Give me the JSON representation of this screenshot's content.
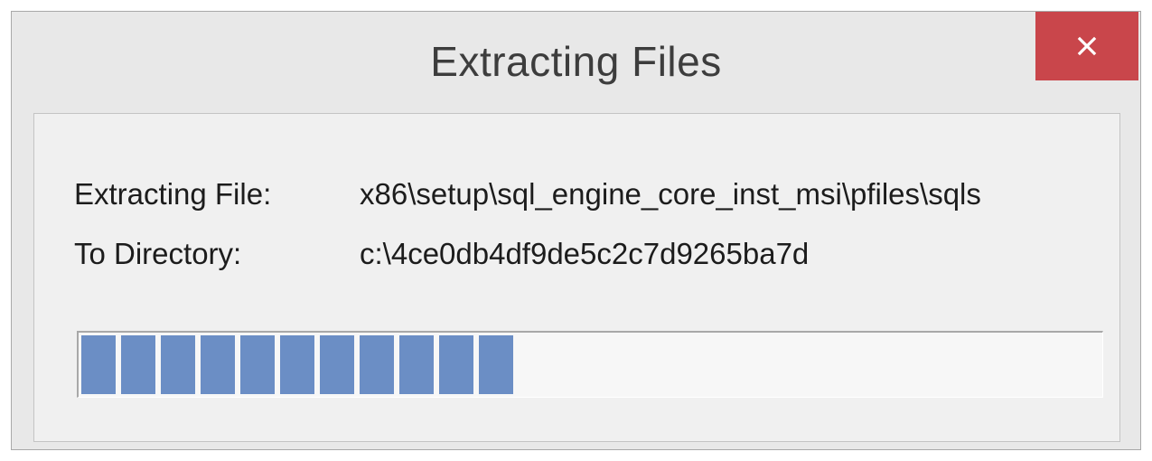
{
  "window": {
    "title": "Extracting Files",
    "close_icon": "close-icon"
  },
  "details": {
    "file_label": "Extracting File:",
    "file_value": "x86\\setup\\sql_engine_core_inst_msi\\pfiles\\sqls",
    "dir_label": "To Directory:",
    "dir_value": "c:\\4ce0db4df9de5c2c7d9265ba7d"
  },
  "progress": {
    "percent": 43,
    "blocks_filled": 11,
    "color": "#6b8ec5"
  },
  "colors": {
    "close_button": "#c9464b",
    "window_background": "#e8e8e8",
    "panel_background": "#f0f0f0"
  }
}
